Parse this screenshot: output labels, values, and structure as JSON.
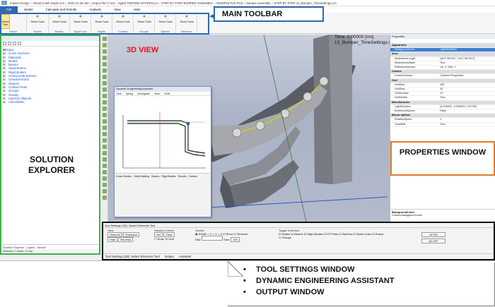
{
  "titlebar": {
    "text": "Impact Design – Visual Crash Studio 8.0 – 2020.10.28 x64 – project file C:\\US – 5gdrd FINFIMEI MATERIALS – STEP BY STEP BUMPER ASSEMBLY – 9/GMPLETUS FILE – bumper assembly – STEP BY STEP 13_Bumper_TimeSettings.vcs"
  },
  "menu": [
    "File",
    "Model",
    "Calculate and Results",
    "Analysis",
    "View",
    "Help"
  ],
  "ribbon": {
    "select": {
      "label": "Select Tool",
      "group": "Select"
    },
    "groups": [
      {
        "label": "Show Tools",
        "group": "Nodes"
      },
      {
        "label": "Show Tools",
        "group": "Beams"
      },
      {
        "label": "Show Tools",
        "group": "Spine Line"
      },
      {
        "label": "Show Tools",
        "group": "Rigids"
      },
      {
        "label": "Show Tools",
        "group": "Contact"
      },
      {
        "label": "Show Tools",
        "group": "Groups"
      },
      {
        "label": "Show Tools",
        "group": "Special"
      },
      {
        "label": "Show Tools",
        "group": "Measure"
      }
    ]
  },
  "callouts": {
    "main_toolbar": "MAIN TOOLBAR",
    "solution_explorer": "SOLUTION EXPLORER",
    "view_3d": "3D VIEW",
    "properties": "PROPERTIES WINDOW",
    "bullets": [
      "TOOL SETTINGS WINDOW",
      "DYNAMIC ENGINEERING ASSISTANT",
      "OUTPUT WINDOW"
    ]
  },
  "solution_tree": {
    "root": "Solution",
    "items": [
      "Cross Sections",
      "Materials",
      "Nodes",
      "Beams",
      "Superbeams",
      "Rigid Bodies",
      "Honeycomb barriers",
      "Characteristics",
      "Objects",
      "Contact Pairs",
      "Groups",
      "Gravity",
      "Injection Objects",
      "Assemblies"
    ]
  },
  "left_tabs": [
    "Solution Explorer",
    "Layers",
    "Search"
  ],
  "left_status": "Selected: 1   Mass: 0.0 kg",
  "viewport": {
    "time": "Time: 0.00000 [ms]",
    "file": "13_Bumper_TimeSettings.vcs"
  },
  "subwindow": {
    "title": "Dynamic Engineering Assistant",
    "tabs": [
      "Time",
      "Spring",
      "Workspace",
      "View",
      "Tools"
    ],
    "bottom_tabs": [
      "Cross Section",
      "Solid Building",
      "Beams",
      "Rigid Bodies",
      "Results",
      "Contact"
    ]
  },
  "properties": {
    "header": "Properties",
    "rows": [
      {
        "cat": "Appearance"
      },
      {
        "k": "BackgroundColor",
        "v": "LightSteelBlue",
        "sel": true
      },
      {
        "cat": "Axes"
      },
      {
        "k": "ModelAxesLength",
        "v": "[1617.55/7617, 1617.55/7617]"
      },
      {
        "k": "ModelAxesVisible",
        "v": "True"
      },
      {
        "k": "ReferenceVectors",
        "v": "Up: Z, Side: 1"
      },
      {
        "cat": "Camera"
      },
      {
        "k": "CurrentCamera",
        "v": "Camera Perspective"
      },
      {
        "cat": "Grid"
      },
      {
        "k": "GridSize",
        "v": "100"
      },
      {
        "k": "GridStep",
        "v": "10"
      },
      {
        "k": "GridSurface",
        "v": "XY"
      },
      {
        "k": "GridVisible",
        "v": "True"
      },
      {
        "cat": "Miscellaneous"
      },
      {
        "k": "LightDirection",
        "v": "(0.578903, -0.578903, 0.57735)"
      },
      {
        "k": "ReferenceSphere",
        "v": "False"
      },
      {
        "cat": "Mouse options"
      },
      {
        "k": "RotationSpeed",
        "v": "1"
      },
      {
        "k": "TrackBall",
        "v": "True"
      }
    ],
    "desc_title": "BackgroundColor",
    "desc_text": "Current background color"
  },
  "tool_settings": {
    "title": "Tool Settings (3D): Select Elements Tool",
    "view_label": "View",
    "view_buttons": [
      "Show All",
      "Exclusive",
      "Hide",
      "Reverse"
    ],
    "rotation_label": "Rotation Center",
    "rotation_buttons": [
      "Set",
      "Clear"
    ],
    "snap_label": "Snap To Grid",
    "section_label": "Section",
    "section_options": [
      "NONE",
      "X",
      "Y",
      "Z"
    ],
    "section_show": "Show",
    "section_reverse": "Reverse",
    "dist_label": "Dist:",
    "size_label": "Size:",
    "size_value": "100",
    "toggle_label": "Toggle Selection",
    "toggles": [
      "Nodes",
      "Beams",
      "Rigid Bodies",
      "FS Parts",
      "Barriers",
      "Spine Lines",
      "Rulers"
    ],
    "groups_label": "Groups",
    "all_on": "All ON",
    "all_off": "All OFF",
    "status_tabs": [
      "Tool Settings (3D): Select Elements Tool",
      "Output",
      "Assistant"
    ]
  }
}
